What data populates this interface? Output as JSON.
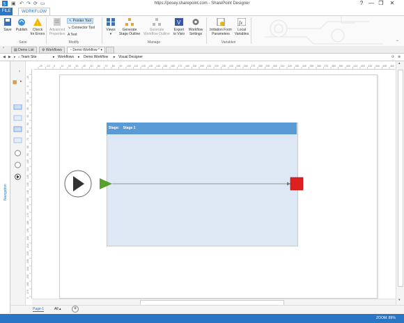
{
  "window": {
    "title": "https://posey.sharepoint.com - SharePoint Designer",
    "help": "?",
    "minimize": "—",
    "restore": "❐",
    "close": "✕"
  },
  "ribbon_tabs": {
    "file": "FILE",
    "workflow": "WORKFLOW"
  },
  "ribbon": {
    "save": "Save",
    "publish": "Publish",
    "check_errors_1": "Check",
    "check_errors_2": "for Errors",
    "advanced_1": "Advanced",
    "advanced_2": "Properties",
    "pointer_tool": "Pointer Tool",
    "connector_tool": "Connector Tool",
    "text": "Text",
    "views": "Views",
    "generate_outline_1": "Generate",
    "generate_outline_2": "Stage Outline",
    "generate_wf_outline_1": "Generate",
    "generate_wf_outline_2": "Workflow Outline",
    "export_1": "Export",
    "export_2": "to Visio",
    "wf_settings_1": "Workflow",
    "wf_settings_2": "Settings",
    "init_1": "Initiation Form",
    "init_2": "Parameters",
    "local_1": "Local",
    "local_2": "Variables",
    "group_save": "Save",
    "group_modify": "Modify",
    "group_manage": "Manage",
    "group_variables": "Variables"
  },
  "doc_tabs": [
    "Demo List",
    "Workflows",
    "Demo Workflow *"
  ],
  "breadcrumb": [
    "Team Site",
    "Workflows",
    "Demo Workflow",
    "Visual Designer"
  ],
  "nav_label": "Navigation",
  "ruler_h": [
    "-20",
    "-10",
    "0",
    "10",
    "20",
    "30",
    "40",
    "50",
    "60",
    "70",
    "80",
    "90",
    "100",
    "110",
    "120",
    "130",
    "140",
    "150",
    "160",
    "170",
    "180",
    "190",
    "200",
    "210",
    "220",
    "230",
    "240",
    "250",
    "260",
    "270",
    "280",
    "290",
    "300",
    "310",
    "320",
    "330",
    "340",
    "350",
    "360",
    "370",
    "380",
    "390",
    "400",
    "410",
    "420",
    "430",
    "440",
    "450",
    "460",
    "470"
  ],
  "ruler_v": [
    "-10",
    "0",
    "10",
    "20",
    "30",
    "40",
    "50",
    "60",
    "70",
    "80",
    "90",
    "100",
    "110",
    "120",
    "130",
    "140",
    "150",
    "160",
    "170",
    "180",
    "190",
    "200",
    "210",
    "220",
    "230",
    "240",
    "250",
    "260",
    "270",
    "280"
  ],
  "stage": {
    "prefix": "Stage:",
    "name": "Stage 1"
  },
  "page_tabs": {
    "page": "Page-1",
    "all": "All ▴",
    "add": "+"
  },
  "status": {
    "zoom": "ZOOM: 89%"
  },
  "colors": {
    "accent": "#2a75c4",
    "stage_header": "#5b9bd5",
    "stage_body": "#dde8f4",
    "start_arrow": "#5aa02c",
    "end": "#e02020"
  }
}
